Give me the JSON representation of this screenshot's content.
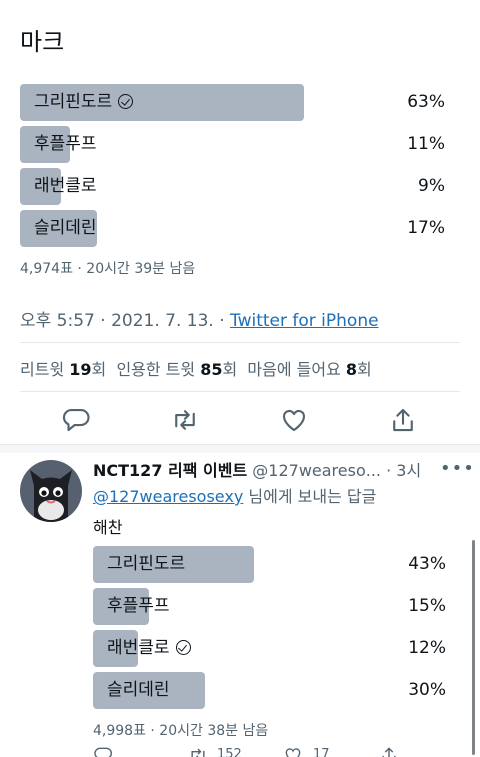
{
  "tweet": {
    "text": "마크",
    "poll": {
      "options": [
        {
          "label": "그리핀도르",
          "percent": "63%",
          "fraction": 0.63,
          "selected": true
        },
        {
          "label": "후플푸프",
          "percent": "11%",
          "fraction": 0.11,
          "selected": false
        },
        {
          "label": "래번클로",
          "percent": "9%",
          "fraction": 0.09,
          "selected": false
        },
        {
          "label": "슬리데린",
          "percent": "17%",
          "fraction": 0.17,
          "selected": false
        }
      ],
      "meta": "4,974표 · 20시간 39분 남음"
    },
    "timestamp": "오후 5:57 · 2021. 7. 13. · ",
    "source": "Twitter for iPhone",
    "stats": {
      "retweets_label": "리트윗",
      "retweets_count": "19",
      "retweets_suffix": "회",
      "quotes_label": "인용한 트윗",
      "quotes_count": "85",
      "quotes_suffix": "회",
      "likes_label": "마음에 들어요",
      "likes_count": "8",
      "likes_suffix": "회"
    },
    "actions": [
      "reply-icon",
      "retweet-icon",
      "like-icon",
      "share-icon"
    ]
  },
  "reply": {
    "display_name": "NCT127 리팩 이벤트",
    "handle": "@127wearesо...",
    "time": " · 3시",
    "replying_to_handle": "@127wearesosexy",
    "replying_to_suffix": " 님에게 보내는 답글",
    "text": "해찬",
    "poll": {
      "options": [
        {
          "label": "그리핀도르",
          "percent": "43%",
          "fraction": 0.43,
          "selected": false
        },
        {
          "label": "후플푸프",
          "percent": "15%",
          "fraction": 0.15,
          "selected": false
        },
        {
          "label": "래번클로",
          "percent": "12%",
          "fraction": 0.12,
          "selected": true
        },
        {
          "label": "슬리데린",
          "percent": "30%",
          "fraction": 0.3,
          "selected": false
        }
      ],
      "meta": "4,998표 · 20시간 38분 남음"
    },
    "bottom": {
      "retweets": "152",
      "likes": "17"
    }
  },
  "colors": {
    "bar": "#aab4c0",
    "link": "#1d6fb8",
    "muted": "#536471"
  }
}
